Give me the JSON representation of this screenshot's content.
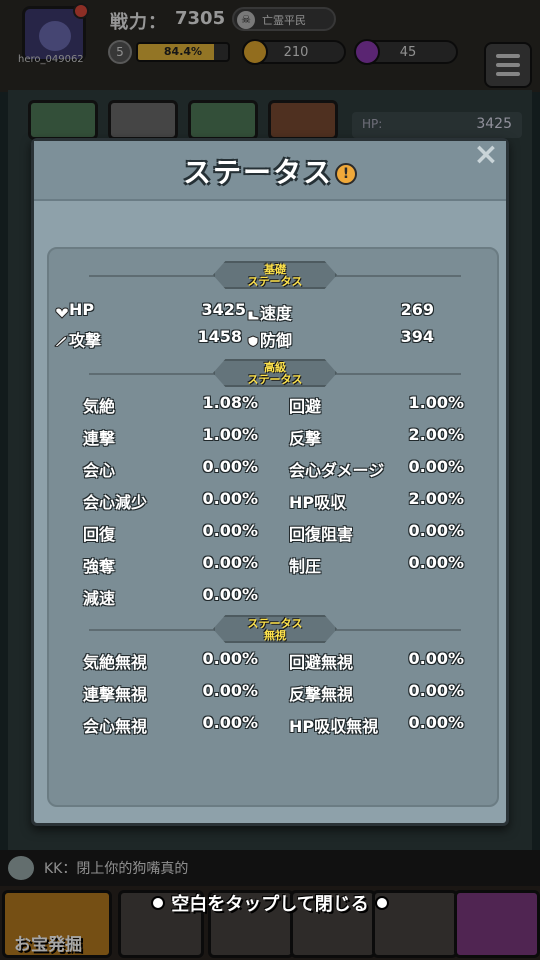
{
  "topbar": {
    "player_id": "hero_049062",
    "power_label": "戦力：",
    "power_value": "7305",
    "rank": "亡霊平民",
    "level": "5",
    "exp_percent": "84.4%",
    "exp_fraction": 0.844,
    "coins": "210",
    "gems": "45"
  },
  "background": {
    "hp_label": "HP:",
    "hp_value": "3425"
  },
  "modal": {
    "title": "ステータス",
    "info_icon": "!",
    "close": "×",
    "sections": {
      "basic": {
        "line1": "基礎",
        "line2": "ステータス"
      },
      "advanced": {
        "line1": "高級",
        "line2": "ステータス"
      },
      "ignore": {
        "line1": "ステータス",
        "line2": "無視"
      }
    },
    "basic": [
      {
        "label": "HP",
        "value": "3425",
        "icon": "heart-icon"
      },
      {
        "label": "速度",
        "value": "269",
        "icon": "boot-icon"
      },
      {
        "label": "攻撃",
        "value": "1458",
        "icon": "sword-icon"
      },
      {
        "label": "防御",
        "value": "394",
        "icon": "shield-icon"
      }
    ],
    "advanced": [
      {
        "label": "気絶",
        "value": "1.08%"
      },
      {
        "label": "回避",
        "value": "1.00%"
      },
      {
        "label": "連撃",
        "value": "1.00%"
      },
      {
        "label": "反撃",
        "value": "2.00%"
      },
      {
        "label": "会心",
        "value": "0.00%"
      },
      {
        "label": "会心ダメージ",
        "value": "0.00%"
      },
      {
        "label": "会心減少",
        "value": "0.00%"
      },
      {
        "label": "HP吸収",
        "value": "2.00%"
      },
      {
        "label": "回復",
        "value": "0.00%"
      },
      {
        "label": "回復阻害",
        "value": "0.00%"
      },
      {
        "label": "強奪",
        "value": "0.00%"
      },
      {
        "label": "制圧",
        "value": "0.00%"
      },
      {
        "label": "減速",
        "value": "0.00%"
      }
    ],
    "ignore": [
      {
        "label": "気絶無視",
        "value": "0.00%"
      },
      {
        "label": "回避無視",
        "value": "0.00%"
      },
      {
        "label": "連撃無視",
        "value": "0.00%"
      },
      {
        "label": "反撃無視",
        "value": "0.00%"
      },
      {
        "label": "会心無視",
        "value": "0.00%"
      },
      {
        "label": "HP吸収無視",
        "value": "0.00%"
      }
    ]
  },
  "chat": {
    "message": "KK：閉上你的狗嘴真的"
  },
  "bottom": {
    "hint": "空白をタップして閉じる",
    "treasure_label": "お宝発掘"
  },
  "colors": {
    "modal_bg": "#8ea1aa",
    "inner_bg": "#7b8d95",
    "banner_text": "#fde24b",
    "exp_fill": "#e2b43a"
  }
}
